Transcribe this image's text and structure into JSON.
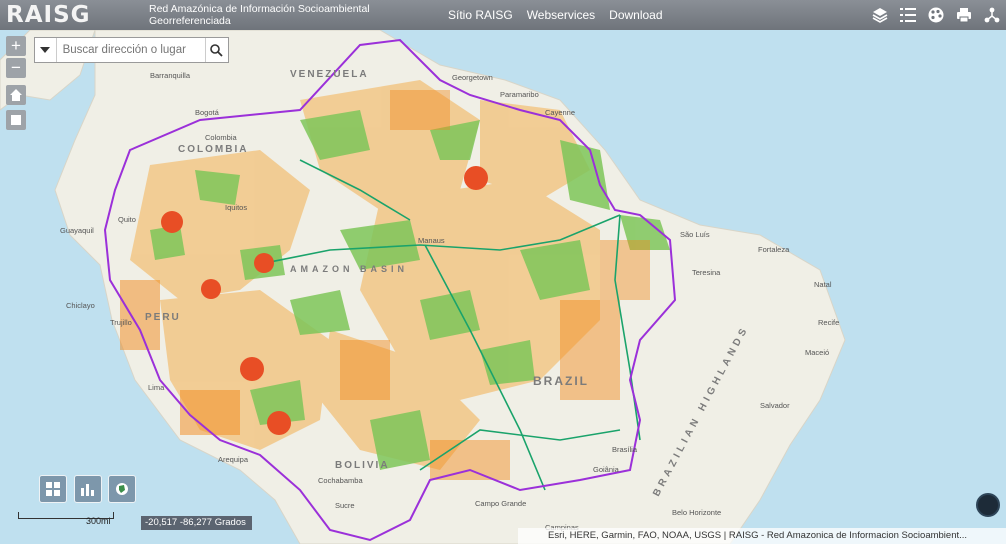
{
  "header": {
    "logo": "RAISG",
    "subtitle": "Red Amazónica de Información Socioambiental Georreferenciada",
    "nav": [
      "Sítio RAISG",
      "Webservices",
      "Download"
    ]
  },
  "toolbar": {
    "icons": [
      "layers-icon",
      "legend-list-icon",
      "basemap-palette-icon",
      "print-icon",
      "share-network-icon"
    ]
  },
  "zoom": {
    "in_label": "+",
    "out_label": "−"
  },
  "search": {
    "placeholder": "Buscar dirección o lugar"
  },
  "map_labels": {
    "countries": [
      "VENEZUELA",
      "COLOMBIA",
      "PERU",
      "BRAZIL",
      "BOLIVIA"
    ],
    "amazon_basin": "AMAZON BASIN",
    "highlands": "BRAZILIAN HIGHLANDS",
    "cities": [
      "Barranquilla",
      "Bogotá",
      "Colombia",
      "Georgetown",
      "Paramaribo",
      "Cayenne",
      "Guayaquil",
      "Manaus",
      "São Luís",
      "Fortaleza",
      "Teresina",
      "Natal",
      "Recife",
      "Maceió",
      "Salvador",
      "Brasília",
      "Goiânia",
      "Belo Horizonte",
      "Campo Grande",
      "Campinas",
      "Cochabamba",
      "Sucre",
      "Lima",
      "Trujillo",
      "Chiclayo",
      "Quito",
      "Arequipa",
      "Iquitos"
    ]
  },
  "scale": {
    "label": "300mi"
  },
  "coordinates": {
    "text": "-20,517 -86,277 Grados"
  },
  "attribution": "Esri, HERE, Garmin, FAO, NOAA, USGS | RAISG - Red Amazonica de Informacion Socioambient...",
  "colors": {
    "header": "#7b8088",
    "ocean": "#bfe0ef",
    "land": "#f0efe6",
    "amazon_boundary": "#9b30d9",
    "protected_area": "#7fc65a",
    "indigenous_territory": "#f2c98c",
    "deforestation": "#f28a1e",
    "hotspot": "#e84e25",
    "rivers": "#1aa36b"
  }
}
